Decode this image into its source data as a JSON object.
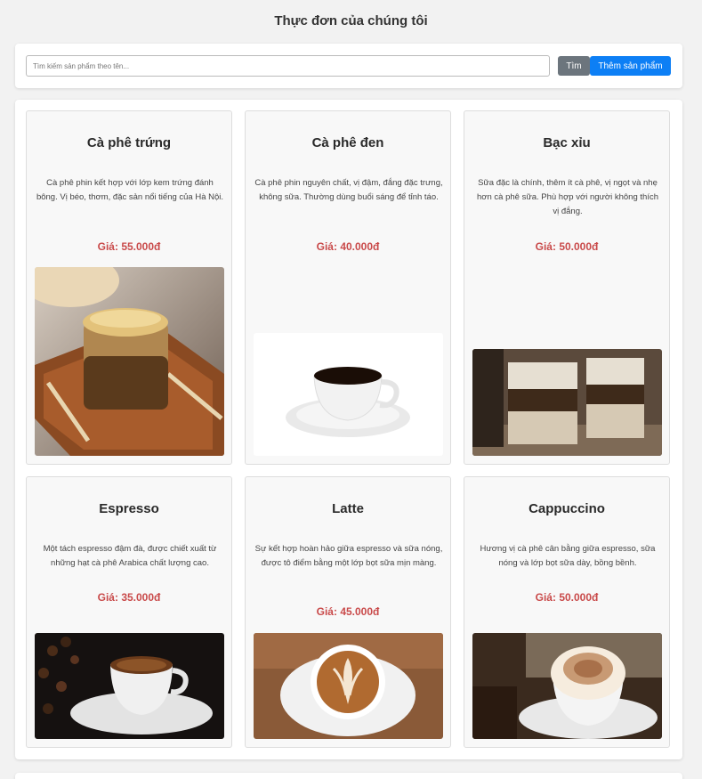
{
  "page": {
    "title": "Thực đơn của chúng tôi"
  },
  "search": {
    "placeholder": "Tìm kiếm sản phẩm theo tên...",
    "value": "",
    "search_label": "Tìm",
    "add_label": "Thêm sản phẩm"
  },
  "colors": {
    "price": "#c94a4a",
    "search_button": "#6c757d",
    "add_button": "#0d7ff5"
  },
  "products": [
    {
      "name": "Cà phê trứng",
      "description": "Cà phê phin kết hợp với lớp kem trứng đánh bông. Vị béo, thơm, đặc sản nổi tiếng của Hà Nội.",
      "price": "Giá: 55.000đ",
      "image": "egg-coffee-photo"
    },
    {
      "name": "Cà phê đen",
      "description": "Cà phê phin nguyên chất, vị đậm, đắng đặc trưng, không sữa. Thường dùng buổi sáng để tỉnh táo.",
      "price": "Giá: 40.000đ",
      "image": "black-coffee-photo"
    },
    {
      "name": "Bạc xỉu",
      "description": "Sữa đặc là chính, thêm ít cà phê, vị ngọt và nhẹ hơn cà phê sữa. Phù hợp với người không thích vị đắng.",
      "price": "Giá: 50.000đ",
      "image": "bac-xiu-photo"
    },
    {
      "name": "Espresso",
      "description": "Một tách espresso đậm đà, được chiết xuất từ những hạt cà phê Arabica chất lượng cao.",
      "price": "Giá: 35.000đ",
      "image": "espresso-photo"
    },
    {
      "name": "Latte",
      "description": "Sự kết hợp hoàn hảo giữa espresso và sữa nóng, được tô điểm bằng một lớp bọt sữa mịn màng.",
      "price": "Giá: 45.000đ",
      "image": "latte-photo"
    },
    {
      "name": "Cappuccino",
      "description": "Hương vị cà phê cân bằng giữa espresso, sữa nóng và lớp bọt sữa dày, bồng bềnh.",
      "price": "Giá: 50.000đ",
      "image": "cappuccino-photo"
    }
  ]
}
